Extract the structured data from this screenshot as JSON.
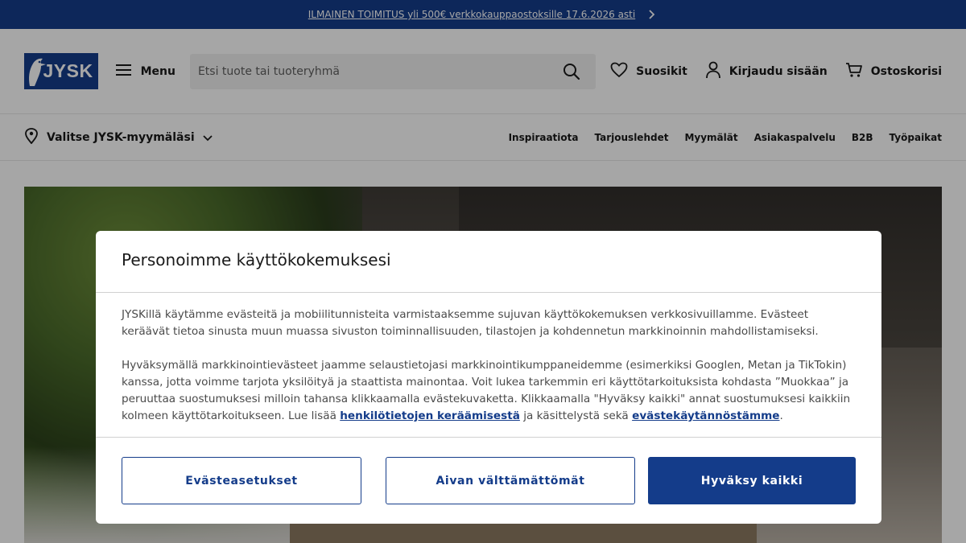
{
  "promo": {
    "text": "ILMAINEN TOIMITUS yli 500€ verkkokauppaostoksille 17.6.2026 asti",
    "icon": "chevron-right-icon"
  },
  "header": {
    "logo_text": "JYSK",
    "menu_label": "Menu",
    "search_placeholder": "Etsi tuote tai tuoteryhmä",
    "favorites_label": "Suosikit",
    "login_label": "Kirjaudu sisään",
    "cart_label": "Ostoskorisi"
  },
  "subnav": {
    "store_label": "Valitse JYSK-myymäläsi",
    "links": [
      "Inspiraatiota",
      "Tarjouslehdet",
      "Myymälät",
      "Asiakaspalvelu",
      "B2B",
      "Työpaikat"
    ]
  },
  "modal": {
    "title": "Personoimme käyttökokemuksesi",
    "p1": "JYSKillä käytämme evästeitä ja mobiilitunnisteita varmistaaksemme sujuvan käyttökokemuksen verkkosivuillamme. Evästeet keräävät tietoa sinusta muun muassa sivuston toiminnallisuuden, tilastojen ja kohdennetun markkinoinnin mahdollistamiseksi.",
    "p2_start": "Hyväksymällä markkinointievästeet jaamme selaustietojasi markkinointikumppaneidemme (esimerkiksi Googlen, Metan ja TikTokin) kanssa, jotta voimme tarjota yksilöityä ja staattista mainontaa. Voit lukea tarkemmin eri käyttötarkoituksista kohdasta ”Muokkaa” ja peruuttaa suostumuksesi milloin tahansa klikkaamalla evästekuvaketta. Klikkaamalla \"Hyväksy kaikki\" annat suostumuksesi kaikkiin kolmeen käyttötarkoitukseen. Lue lisää ",
    "link1": "henkilötietojen keräämisestä",
    "p2_mid": " ja käsittelystä sekä ",
    "link2": "evästekäytännöstämme",
    "p2_end": ".",
    "btn_settings": "Evästeasetukset",
    "btn_necessary": "Aivan välttämättömät",
    "btn_accept": "Hyväksy kaikki"
  },
  "colors": {
    "brand": "#143c8a"
  }
}
